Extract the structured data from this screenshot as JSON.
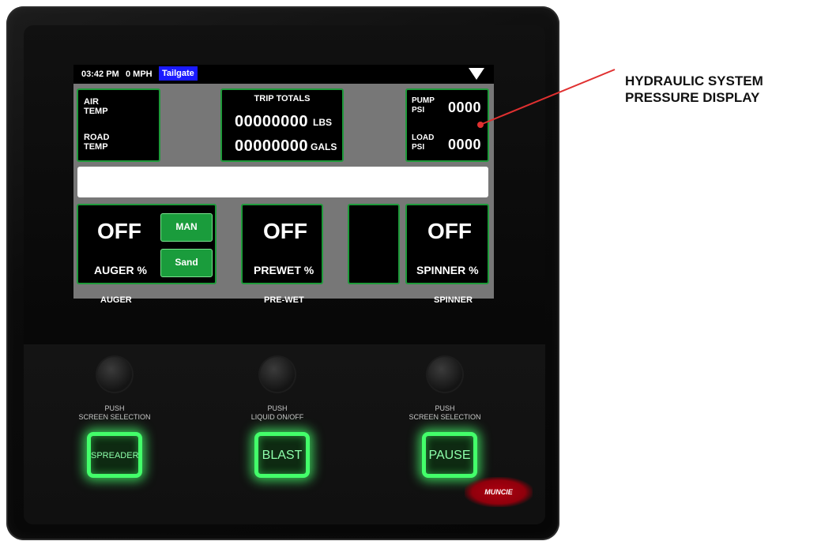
{
  "status": {
    "time": "03:42 PM",
    "speed": "0 MPH",
    "mode": "Tailgate"
  },
  "left_panel": {
    "air_temp_label": "AIR\nTEMP",
    "road_temp_label": "ROAD\nTEMP"
  },
  "trip_totals": {
    "title": "TRIP TOTALS",
    "lbs_value": "00000000",
    "lbs_unit": "LBS",
    "gals_value": "00000000",
    "gals_unit": "GALS"
  },
  "pressure": {
    "pump_label": "PUMP\nPSI",
    "pump_value": "0000",
    "load_label": "LOAD\nPSI",
    "load_value": "0000"
  },
  "auger": {
    "state": "OFF",
    "label": "AUGER %",
    "mode_button": "MAN",
    "material_button": "Sand",
    "caption": "AUGER"
  },
  "prewet": {
    "state": "OFF",
    "label": "PREWET %",
    "caption": "PRE-WET"
  },
  "spinner": {
    "state": "OFF",
    "label": "SPINNER %",
    "caption": "SPINNER"
  },
  "controls": {
    "left_push": "PUSH\nSCREEN SELECTION",
    "center_push": "PUSH\nLIQUID ON/OFF",
    "right_push": "PUSH\nSCREEN SELECTION",
    "spreader_button": "SPREADER",
    "blast_button": "BLAST",
    "pause_button": "PAUSE"
  },
  "brand": "MUNCIE",
  "callout": {
    "text": "HYDRAULIC SYSTEM\nPRESSURE DISPLAY"
  },
  "colors": {
    "accent_green": "#1a9c3c",
    "glow_green": "#43ff6a",
    "callout_line": "#e03030",
    "status_mode": "#1a1aff"
  }
}
